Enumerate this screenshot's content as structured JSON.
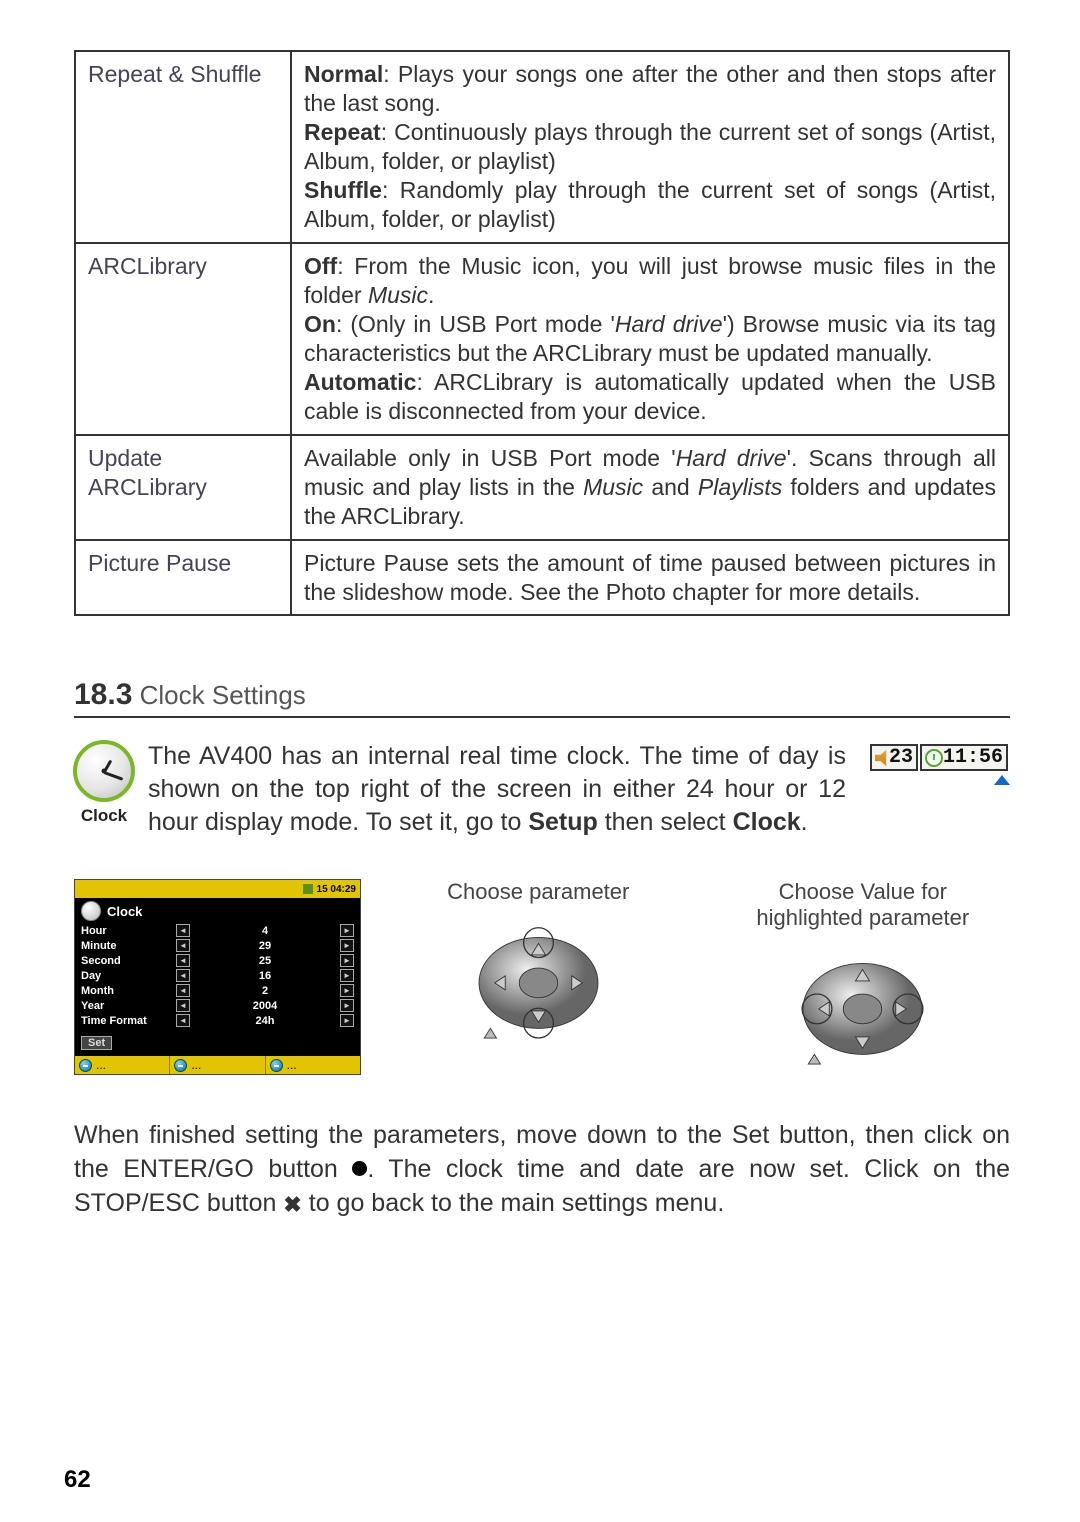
{
  "table": [
    {
      "label": "Repeat & Shuffle",
      "desc_html": "<span class='b'>Normal</span>: Plays your songs one after the other and then stops after the last song.<br><span class='b'>Repeat</span>: Continuously plays through the current set of songs (Artist, Album, folder, or playlist)<br><span class='b'>Shuffle</span>: Randomly play through the current set of songs (Artist, Album, folder, or playlist)"
    },
    {
      "label": "ARCLibrary",
      "desc_html": "<span class='b'>Off</span>: From the Music icon, you will just browse music files in the folder <span class='i'>Music</span>.<br><span class='b'>On</span>: (Only in USB Port mode '<span class='i'>Hard drive</span>') Browse music via its tag characteristics but the ARCLibrary must be updated manually.<br><span class='b'>Automatic</span>: ARCLibrary is automatically updated when the USB cable is disconnected from your device."
    },
    {
      "label": "Update ARCLibrary",
      "desc_html": "Available only in USB Port mode '<span class='i'>Hard drive</span>'. Scans through all music and play lists in the <span class='i'>Music</span> and <span class='i'>Playlists</span> folders and updates the ARCLibrary."
    },
    {
      "label": "Picture Pause",
      "desc_html": "Picture Pause sets the amount of time paused between pictures in the slideshow mode. See the Photo chapter for more details."
    }
  ],
  "section": {
    "num": "18.3",
    "title": " Clock Settings"
  },
  "clock_icon_label": "Clock",
  "intro_html": "The AV400 has an internal real time clock. The time of day is shown on the top right of the screen in either 24 hour or 12 hour display mode. To set it, go to <span class='b'>Setup</span> then select <span class='b'>Clock</span>.",
  "time_badge": {
    "vol": "23",
    "time": "11:56"
  },
  "screenshot": {
    "status": "15   04:29",
    "title": "Clock",
    "rows": [
      {
        "label": "Hour",
        "value": "4"
      },
      {
        "label": "Minute",
        "value": "29"
      },
      {
        "label": "Second",
        "value": "25"
      },
      {
        "label": "Day",
        "value": "16"
      },
      {
        "label": "Month",
        "value": "2"
      },
      {
        "label": "Year",
        "value": "2004"
      },
      {
        "label": "Time Format",
        "value": "24h"
      }
    ],
    "set_button": "Set",
    "bottom_label": "..."
  },
  "pads": {
    "left_caption": "Choose parameter",
    "right_caption_l1": "Choose Value for",
    "right_caption_l2": "highlighted parameter"
  },
  "closing_html": "When finished setting the parameters, move down to the Set button, then click on the ENTER/GO button <span class='sym-enter'></span>. The clock time and date are now set. Click on the STOP/ESC button <span class='sym-stop'>✖</span> to go back to the main settings menu.",
  "page_number": "62"
}
